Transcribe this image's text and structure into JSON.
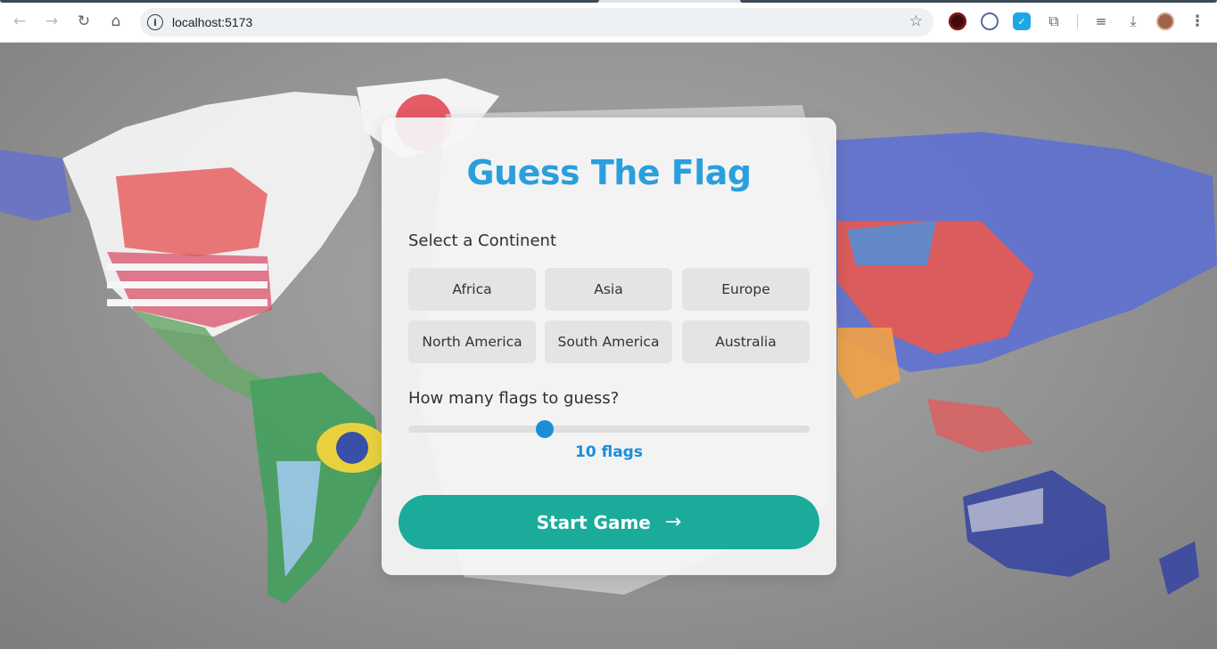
{
  "browser": {
    "url": "localhost:5173",
    "icons": {
      "back": "arrow-left-icon",
      "forward": "arrow-right-icon",
      "reload": "reload-icon",
      "home": "home-icon",
      "site_info": "info-icon",
      "bookmark": "star-icon",
      "extensions": "puzzle-icon",
      "media": "media-control-icon",
      "downloads": "download-icon",
      "menu": "kebab-menu-icon"
    }
  },
  "game": {
    "title": "Guess The Flag",
    "continent_label": "Select a Continent",
    "continents": [
      "Africa",
      "Asia",
      "Europe",
      "North America",
      "South America",
      "Australia"
    ],
    "flags_label": "How many flags to guess?",
    "flag_count_text": "10 flags",
    "slider_fraction": 0.34,
    "start_label": "Start Game",
    "start_arrow": "→"
  },
  "colors": {
    "title": "#2a9fdc",
    "accent": "#1a8fd8",
    "start_button": "#1aab9b"
  }
}
